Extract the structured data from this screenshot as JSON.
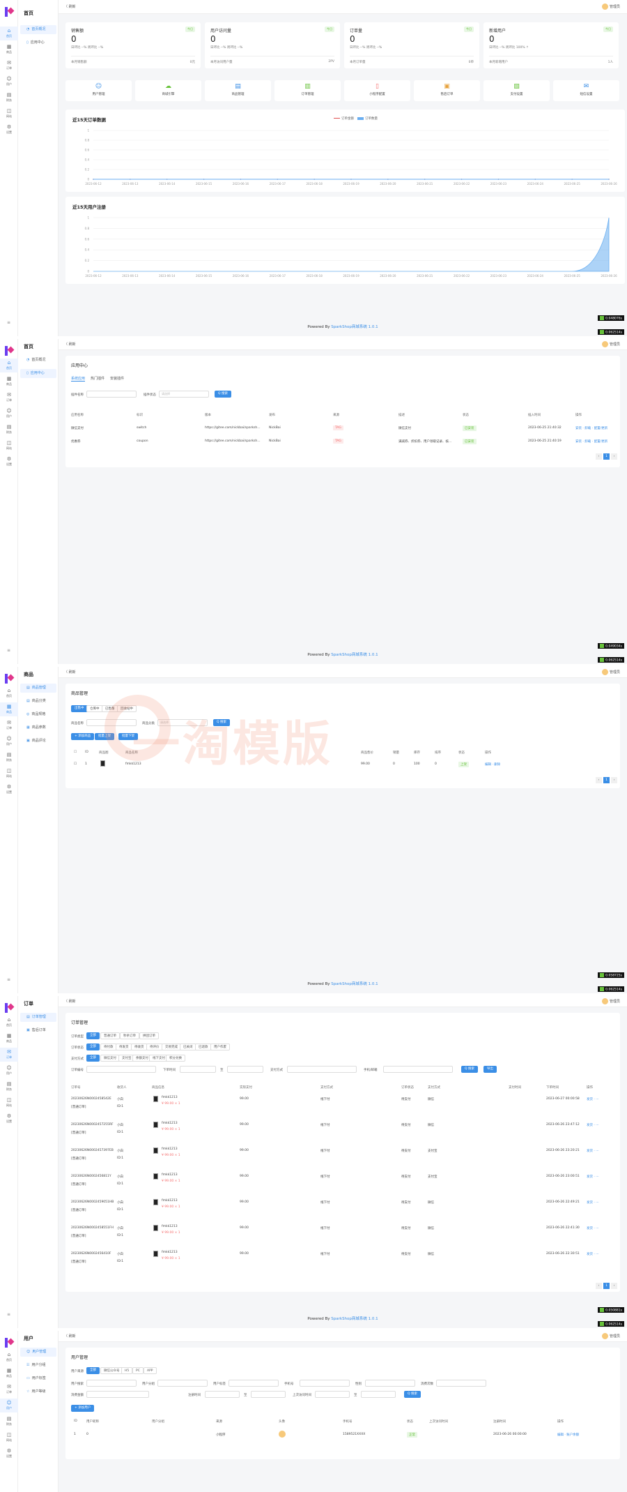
{
  "common": {
    "rail": [
      {
        "icon": "⌂",
        "label": "首页"
      },
      {
        "icon": "▦",
        "label": "商品"
      },
      {
        "icon": "✉",
        "label": "订单"
      },
      {
        "icon": "☺",
        "label": "用户"
      },
      {
        "icon": "▤",
        "label": "财务"
      },
      {
        "icon": "◫",
        "label": "网站"
      },
      {
        "icon": "⚙",
        "label": "设置"
      }
    ],
    "back": "〈 刷新",
    "admin": "管理员",
    "footer_prefix": "Powered By ",
    "footer_link": "SparkShop商城系统 1.0.1",
    "badges": [
      "0.048076s",
      "0.062514s",
      "0.049034s",
      "0.062514s",
      "0.058725s",
      "0.062514s",
      "0.050881s",
      "0.062514s"
    ]
  },
  "dashboard": {
    "nav_title": "首页",
    "subnav": [
      "首页概况",
      "应用中心"
    ],
    "stats": [
      {
        "title": "销售额",
        "tag": "今日",
        "value": "0",
        "ratio": "日环比 --%   周环比 --%",
        "foot_l": "本月销售额",
        "foot_r": "0元"
      },
      {
        "title": "用户访问量",
        "tag": "今日",
        "value": "0",
        "ratio": "日环比 --%   周环比 --%",
        "foot_l": "本月访问用户量",
        "foot_r": "2PV"
      },
      {
        "title": "订单量",
        "tag": "今日",
        "value": "0",
        "ratio": "日环比 --%   周环比 --%",
        "foot_l": "本月订单量",
        "foot_r": "0单"
      },
      {
        "title": "新增用户",
        "tag": "今日",
        "value": "0",
        "ratio": "日环比 --%   周环比 100% ↑",
        "foot_l": "本月新增用户",
        "foot_r": "1人"
      }
    ],
    "quick": [
      {
        "icon": "☺",
        "label": "用户管理",
        "color": "#3a8ee6"
      },
      {
        "icon": "☁",
        "label": "商城引擎",
        "color": "#67c23a"
      },
      {
        "icon": "▤",
        "label": "商品管理",
        "color": "#3a8ee6"
      },
      {
        "icon": "▥",
        "label": "订单管理",
        "color": "#67c23a"
      },
      {
        "icon": "▯",
        "label": "小程序配置",
        "color": "#f56c6c"
      },
      {
        "icon": "▣",
        "label": "售后订单",
        "color": "#e6a23c"
      },
      {
        "icon": "▧",
        "label": "支付设置",
        "color": "#67c23a"
      },
      {
        "icon": "✉",
        "label": "短信设置",
        "color": "#3a8ee6"
      }
    ]
  },
  "chart_data": [
    {
      "type": "line",
      "title": "近15天订单数据",
      "categories": [
        "2023-06-12",
        "2023-06-13",
        "2023-06-14",
        "2023-06-15",
        "2023-06-16",
        "2023-06-17",
        "2023-06-18",
        "2023-06-19",
        "2023-06-20",
        "2023-06-21",
        "2023-06-22",
        "2023-06-23",
        "2023-06-24",
        "2023-06-25",
        "2023-06-26"
      ],
      "series": [
        {
          "name": "订单金额",
          "values": [
            0,
            0,
            0,
            0,
            0,
            0,
            0,
            0,
            0,
            0,
            0,
            0,
            0,
            0,
            0
          ],
          "color": "#e05050"
        },
        {
          "name": "订单数量",
          "values": [
            0,
            0,
            0,
            0,
            0,
            0,
            0,
            0,
            0,
            0,
            0,
            0,
            0,
            0,
            0
          ],
          "color": "#6aaef0"
        }
      ],
      "ylim": [
        0,
        1
      ],
      "yticks": [
        "1",
        "0.8",
        "0.6",
        "0.4",
        "0.2",
        "0"
      ],
      "legend": "top-center",
      "grid": true
    },
    {
      "type": "area",
      "title": "近15天用户注册",
      "categories": [
        "2023-06-12",
        "2023-06-13",
        "2023-06-14",
        "2023-06-15",
        "2023-06-16",
        "2023-06-17",
        "2023-06-18",
        "2023-06-19",
        "2023-06-20",
        "2023-06-21",
        "2023-06-22",
        "2023-06-23",
        "2023-06-24",
        "2023-06-25",
        "2023-06-26"
      ],
      "series": [
        {
          "values": [
            0,
            0,
            0,
            0,
            0,
            0,
            0,
            0,
            0,
            0,
            0,
            0,
            0,
            0,
            1
          ],
          "color": "#6aaef0"
        }
      ],
      "ylim": [
        0,
        1
      ],
      "yticks": [
        "1",
        "0.8",
        "0.6",
        "0.4",
        "0.2",
        "0"
      ],
      "grid": true
    }
  ],
  "apps": {
    "card_title": "应用中心",
    "tabs": [
      "系统应用",
      "热门插件",
      "安装插件"
    ],
    "name_label": "插件名称",
    "status_label": "插件状态",
    "status_placeholder": "请选择",
    "search": "Q 搜索",
    "headers": [
      "应用名称",
      "标识",
      "版本",
      "发布",
      "来源",
      "描述",
      "状态",
      "插入时间",
      "操作"
    ],
    "rows": [
      {
        "name": "微信支付",
        "key": "switch",
        "url": "https://gitee.com/nickbai/sparksh...",
        "author": "NickBai",
        "source": "TAG",
        "desc": "微信支付",
        "status": "已安装",
        "time": "2023-06-25 21:40:32",
        "ops": "安装 · 卸载 · 配置/更新"
      },
      {
        "name": "优惠券",
        "key": "coupon",
        "url": "https://gitee.com/nickbai/sparksh...",
        "author": "NickBai",
        "source": "TAG",
        "desc": "满减券、折扣券、用户领取记录、核...",
        "status": "已安装",
        "time": "2023-06-25 21:40:19",
        "ops": "安装 · 卸载 · 配置/更新"
      }
    ]
  },
  "goods": {
    "nav_title": "商品",
    "subnav": [
      "商品管理",
      "商品分类",
      "商品规格",
      "商品参数",
      "商品评论"
    ],
    "card_title": "商品管理",
    "tabs": [
      "出售中",
      "仓库中",
      "已售罄",
      "回收站中"
    ],
    "name_label": "商品名称",
    "cat_label": "商品分类",
    "cat_placeholder": "请选择",
    "search": "Q 搜索",
    "btns": [
      "+ 添加商品",
      "批量上架",
      "批量下架"
    ],
    "headers": [
      "ID",
      "商品图",
      "商品名称",
      "商品售价",
      "销量",
      "库存",
      "排序",
      "状态",
      "操作"
    ],
    "row": {
      "id": "1",
      "name": "fmkk1213",
      "price": "99.00",
      "sales": "0",
      "stock": "100",
      "sort": "0",
      "status": "上架",
      "ops": "编辑 · 删除"
    },
    "watermark": "一淘模版"
  },
  "orders": {
    "nav_title": "订单",
    "subnav": [
      "订单管理",
      "售后订单"
    ],
    "card_title": "订单管理",
    "filter1_label": "订单类型",
    "filter1": [
      "全部",
      "普通订单",
      "秒杀订单",
      "拼团订单",
      "砍价订单"
    ],
    "filter2_label": "订单状态",
    "filter2": [
      "全部",
      "待付款",
      "待发货",
      "待收货",
      "待评价",
      "交易完成",
      "已关闭",
      "已退款",
      "用户作废"
    ],
    "filter3_label": "支付方式",
    "filter3": [
      "全部",
      "微信支付",
      "支付宝",
      "余额支付",
      "线下支付",
      "积分兑换"
    ],
    "search_labels": [
      "订单编号",
      "下单时间",
      "至",
      "支付方式",
      "手机/邮箱"
    ],
    "search": "Q 搜索",
    "export": "导出",
    "headers": [
      "订单号",
      "收货人",
      "商品信息",
      "实际支付",
      "支付方式",
      "订单状态",
      "支付方式",
      "支付时间",
      "下单时间",
      "操作"
    ],
    "rows": [
      {
        "no": "20230626N0002458542E",
        "type": "[普通订单]",
        "user": "小白",
        "pay": "99.00",
        "method": "线下付",
        "status": "待支付",
        "pay_type": "微信",
        "time": "2023-06-27 00:00:58"
      },
      {
        "no": "20230626N0002457255RF",
        "type": "[普通订单]",
        "user": "小白",
        "pay": "99.00",
        "method": "线下付",
        "status": "待支付",
        "pay_type": "微信",
        "time": "2023-06-26 23:47:12"
      },
      {
        "no": "20230626N0002457397EB",
        "type": "[普通订单]",
        "user": "小白",
        "pay": "99.00",
        "method": "线下付",
        "status": "待支付",
        "pay_type": "支付宝",
        "time": "2023-06-26 23:20:21"
      },
      {
        "no": "20230626N0002456811Y",
        "type": "[普通订单]",
        "user": "小白",
        "pay": "99.00",
        "method": "线下付",
        "status": "待支付",
        "pay_type": "支付宝",
        "time": "2023-06-26 23:00:51"
      },
      {
        "no": "20230626N0002459051HB",
        "type": "[普通订单]",
        "user": "小白",
        "pay": "99.00",
        "method": "线下付",
        "status": "待支付",
        "pay_type": "微信",
        "time": "2023-06-26 22:49:21"
      },
      {
        "no": "20230626N0002458551FH",
        "type": "[普通订单]",
        "user": "小白",
        "pay": "99.00",
        "method": "线下付",
        "status": "待支付",
        "pay_type": "微信",
        "time": "2023-06-26 22:41:30"
      },
      {
        "no": "20230626N0002456410F",
        "type": "[普通订单]",
        "user": "小白",
        "pay": "99.00",
        "method": "线下付",
        "status": "待支付",
        "pay_type": "微信",
        "time": "2023-06-26 22:30:51"
      }
    ],
    "goods_name": "fmkk1213",
    "goods_price": "¥ 99.00 × 1",
    "ops": "发货 · ···"
  },
  "users": {
    "nav_title": "用户",
    "subnav": [
      "用户管理",
      "用户分组",
      "用户标签",
      "用户等级"
    ],
    "card_title": "用户管理",
    "source_label": "用户来源",
    "sources": [
      "全部",
      "微信公众号",
      "H5",
      "PC",
      "APP"
    ],
    "labels": [
      "用户搜索",
      "用户分组",
      "用户标签",
      "手机号",
      "性别",
      "消费次数",
      "消费金额",
      "注册时间",
      "至",
      "上次访问时间",
      "至"
    ],
    "search": "Q 搜索",
    "add": "+ 添加用户",
    "headers": [
      "ID",
      "用户昵称",
      "用户分组",
      "来源",
      "头像",
      "手机号",
      "状态",
      "上次访问时间",
      "注册时间",
      "操作"
    ],
    "row": {
      "id": "1",
      "nick": "0",
      "source": "小程序",
      "phone": "1589521XXXX",
      "status": "正常",
      "reg": "2023-06-26 00:00:00",
      "ops": "编辑 · 账户余额"
    }
  }
}
